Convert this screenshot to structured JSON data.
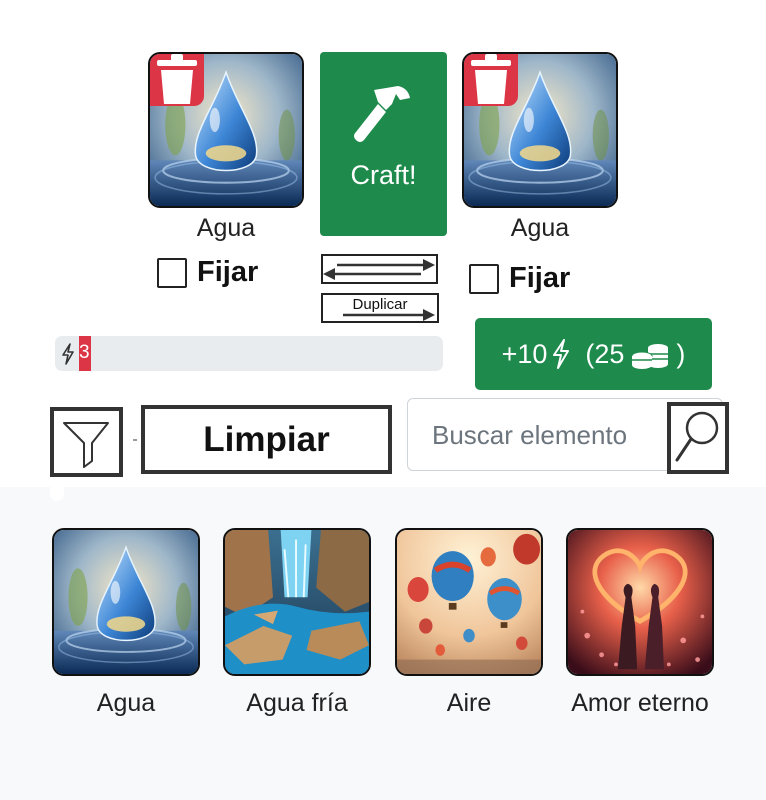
{
  "slots": [
    {
      "name": "Agua",
      "pin_label": "Fijar"
    },
    {
      "name": "Agua",
      "pin_label": "Fijar"
    }
  ],
  "craft": {
    "label": "Craft!"
  },
  "duplicate": {
    "label": "Duplicar"
  },
  "energy": {
    "value": "3"
  },
  "buy": {
    "amount": "+10",
    "cost": "(25",
    "close": ")"
  },
  "toolbar": {
    "clear_label": "Limpiar",
    "search_placeholder": "Buscar elemento"
  },
  "elements": [
    {
      "name": "Agua",
      "icon": "water-drop-image"
    },
    {
      "name": "Agua fría",
      "icon": "waterfall-image"
    },
    {
      "name": "Aire",
      "icon": "hot-air-balloons-image"
    },
    {
      "name": "Amor eterno",
      "icon": "heart-couple-image"
    }
  ],
  "colors": {
    "green": "#1e8a4c",
    "red": "#dc3545",
    "bar": "#e9ecef"
  }
}
